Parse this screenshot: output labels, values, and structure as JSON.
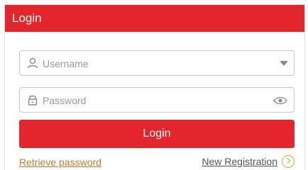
{
  "header": {
    "title": "Login"
  },
  "form": {
    "username": {
      "placeholder": "Username",
      "value": ""
    },
    "password": {
      "placeholder": "Password",
      "value": ""
    },
    "login_label": "Login"
  },
  "links": {
    "retrieve": "Retrieve password",
    "new_registration": "New Registration"
  },
  "colors": {
    "accent": "#e3262b",
    "link_accent": "#c8782b",
    "icon_accent": "#e0a030"
  },
  "icons": {
    "username": "user-icon",
    "password": "lock-icon",
    "dropdown": "chevron-down-icon",
    "visibility": "eye-icon",
    "registration": "chevron-right-circle-icon"
  }
}
